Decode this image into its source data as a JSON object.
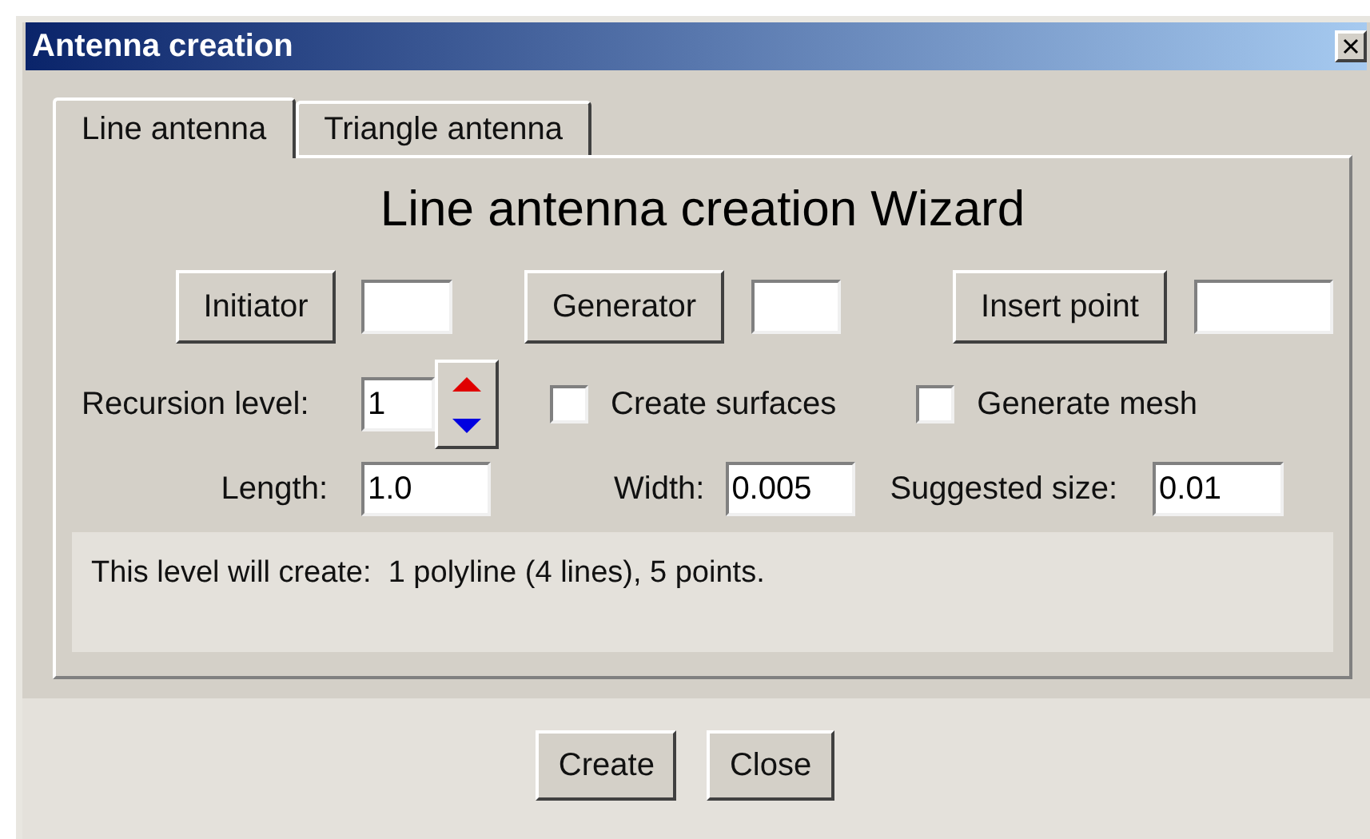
{
  "window": {
    "title": "Antenna creation"
  },
  "tabs": [
    {
      "label": "Line antenna",
      "selected": true
    },
    {
      "label": "Triangle antenna",
      "selected": false
    }
  ],
  "heading": "Line antenna creation Wizard",
  "pickers": [
    {
      "button": "Initiator"
    },
    {
      "button": "Generator"
    },
    {
      "button": "Insert point"
    }
  ],
  "recursion": {
    "label": "Recursion level:",
    "value": "1"
  },
  "checkboxes": [
    {
      "label": "Create surfaces",
      "checked": false
    },
    {
      "label": "Generate mesh",
      "checked": false
    }
  ],
  "fields": [
    {
      "label": "Length:",
      "value": "1.0"
    },
    {
      "label": "Width:",
      "value": "0.005"
    },
    {
      "label": "Suggested size:",
      "value": "0.01"
    }
  ],
  "info": "This level will create:  1 polyline (4 lines), 5 points.",
  "buttons": [
    "Create",
    "Close"
  ]
}
